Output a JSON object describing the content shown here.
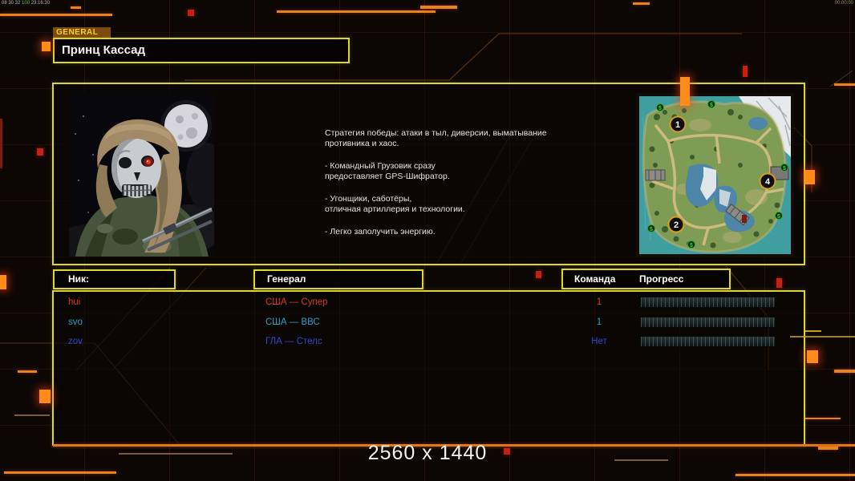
{
  "status_bar": {
    "left_1": "08 30 32",
    "left_2": "100",
    "left_3": "23:16:30",
    "right_text": "00:00:00"
  },
  "header": {
    "tag": "GENERAL",
    "title": "Принц Кассад"
  },
  "briefing": {
    "paragraphs": [
      "Стратегия победы: атаки в тыл, диверсии, выматывание\n противника и хаос.",
      "- Командный Грузовик сразу\nпредоставляет GPS-Шифратор.",
      "- Угонщики, саботёры,\nотличная артиллерия и технологии.",
      "- Легко заполучить энергию."
    ]
  },
  "minimap": {
    "markers": [
      "1",
      "2",
      "4"
    ],
    "supply_symbol": "$"
  },
  "lobby_table": {
    "headers": {
      "nick": "Ник:",
      "general": "Генерал",
      "team": "Команда",
      "progress": "Прогресс"
    },
    "rows": [
      {
        "nick": "hui",
        "general": "США — Супер",
        "team": "1",
        "progress_percent": 0,
        "color": "#d23a2a"
      },
      {
        "nick": "svo",
        "general": "США — ВВС",
        "team": "1",
        "progress_percent": 0,
        "color": "#2e9fc4"
      },
      {
        "nick": "zov",
        "general": "ГЛА — Стелс",
        "team": "Нет",
        "progress_percent": 0,
        "color": "#3346cf"
      }
    ]
  },
  "footer": {
    "resolution": "2560 x 1440"
  },
  "colors": {
    "accent_yellow": "#ddd72c",
    "accent_orange": "#ff8c1a",
    "background": "#0c0705",
    "red_player": "#d23a2a",
    "cyan_player": "#2e9fc4",
    "blue_player": "#3346cf"
  }
}
